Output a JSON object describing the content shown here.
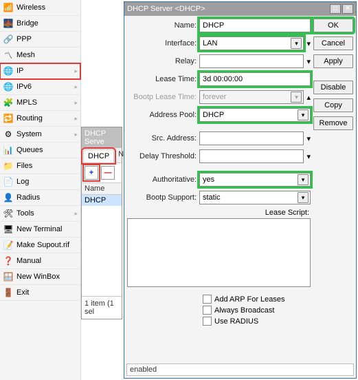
{
  "sidebar": {
    "items": [
      {
        "label": "Wireless",
        "icon": "📶",
        "expand": false
      },
      {
        "label": "Bridge",
        "icon": "🌉",
        "expand": false
      },
      {
        "label": "PPP",
        "icon": "🔗",
        "expand": false
      },
      {
        "label": "Mesh",
        "icon": "〽",
        "expand": false
      },
      {
        "label": "IP",
        "icon": "🌐",
        "expand": true,
        "highlight": true
      },
      {
        "label": "IPv6",
        "icon": "🌐",
        "expand": true
      },
      {
        "label": "MPLS",
        "icon": "🧩",
        "expand": true
      },
      {
        "label": "Routing",
        "icon": "🔁",
        "expand": true
      },
      {
        "label": "System",
        "icon": "⚙",
        "expand": true
      },
      {
        "label": "Queues",
        "icon": "📊",
        "expand": false
      },
      {
        "label": "Files",
        "icon": "📁",
        "expand": false
      },
      {
        "label": "Log",
        "icon": "📄",
        "expand": false
      },
      {
        "label": "Radius",
        "icon": "👤",
        "expand": false
      },
      {
        "label": "Tools",
        "icon": "🛠",
        "expand": true
      },
      {
        "label": "New Terminal",
        "icon": "🖥",
        "expand": false
      },
      {
        "label": "Make Supout.rif",
        "icon": "📝",
        "expand": false
      },
      {
        "label": "Manual",
        "icon": "❓",
        "expand": false
      },
      {
        "label": "New WinBox",
        "icon": "🪟",
        "expand": false
      },
      {
        "label": "Exit",
        "icon": "🚪",
        "expand": false
      }
    ]
  },
  "listWindow": {
    "title": "DHCP Serve",
    "tab": "DHCP",
    "nePrefix": "Ne",
    "addGlyph": "+",
    "removeGlyph": "—",
    "header": "Name",
    "row": "DHCP",
    "status": "1 item (1 sel"
  },
  "dialog": {
    "title": "DHCP Server <DHCP>",
    "buttons": {
      "ok": "OK",
      "cancel": "Cancel",
      "apply": "Apply",
      "disable": "Disable",
      "copy": "Copy",
      "remove": "Remove"
    },
    "labels": {
      "name": "Name:",
      "interface": "Interface:",
      "relay": "Relay:",
      "leaseTime": "Lease Time:",
      "bootpLeaseTime": "Bootp Lease Time:",
      "addressPool": "Address Pool:",
      "srcAddress": "Src. Address:",
      "delayThreshold": "Delay Threshold:",
      "authoritative": "Authoritative:",
      "bootpSupport": "Bootp Support:",
      "leaseScript": "Lease Script:",
      "addArp": "Add ARP For Leases",
      "alwaysBroadcast": "Always Broadcast",
      "useRadius": "Use RADIUS"
    },
    "values": {
      "name": "DHCP",
      "interface": "LAN",
      "relay": "",
      "leaseTime": "3d 00:00:00",
      "bootpLeaseTime": "forever",
      "addressPool": "DHCP",
      "srcAddress": "",
      "delayThreshold": "",
      "authoritative": "yes",
      "bootpSupport": "static"
    },
    "status": "enabled"
  }
}
